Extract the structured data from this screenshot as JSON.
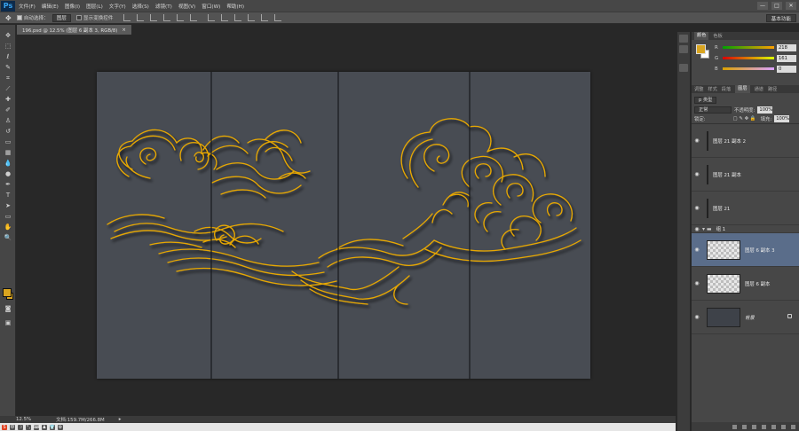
{
  "app": {
    "logo": "Ps"
  },
  "menubar": {
    "items": [
      "文件(F)",
      "编辑(E)",
      "图像(I)",
      "图层(L)",
      "文字(Y)",
      "选择(S)",
      "滤镜(T)",
      "视图(V)",
      "窗口(W)",
      "帮助(H)"
    ],
    "window_controls": [
      "—",
      "□",
      "✕"
    ]
  },
  "options": {
    "auto_select_label": "自动选择：",
    "auto_select_value": "图层",
    "transform_controls_label": "显示变换控件",
    "workspace": "基本功能"
  },
  "document": {
    "tab_title": "196.psd @ 12.5% (图层 6 副本 3, RGB/8)",
    "tab_close": "×"
  },
  "status": {
    "zoom": "12.5%",
    "doc_info": "文档:159.7M/266.8M",
    "arrow": "▸"
  },
  "taskbar": {
    "items": [
      "S",
      "中",
      "☽",
      "°,",
      "⌨",
      "♟",
      "👕",
      "⚙"
    ]
  },
  "color_panel": {
    "tabs": [
      "颜色",
      "色板"
    ],
    "fg_color": "#d9a520",
    "R": "218",
    "G": "161",
    "B": "0"
  },
  "layers_panel": {
    "tabs": [
      "调整",
      "样式",
      "段落",
      "图层",
      "通道",
      "路径"
    ],
    "kind_label": "p 类型",
    "blend_mode": "正常",
    "opacity_label": "不透明度:",
    "opacity_value": "100%",
    "lock_label": "锁定:",
    "fill_label": "填充:",
    "fill_value": "100%",
    "layers": [
      {
        "name": "图层 21 副本 2"
      },
      {
        "name": "图层 21 副本"
      },
      {
        "name": "图层 21"
      },
      {
        "name": "组 1"
      },
      {
        "name": "图层 6 副本 3"
      },
      {
        "name": "图层 6 副本"
      },
      {
        "name": "背景"
      }
    ]
  },
  "artwork": {
    "line_color": "#e8a800",
    "panel_color": "#484c53"
  }
}
